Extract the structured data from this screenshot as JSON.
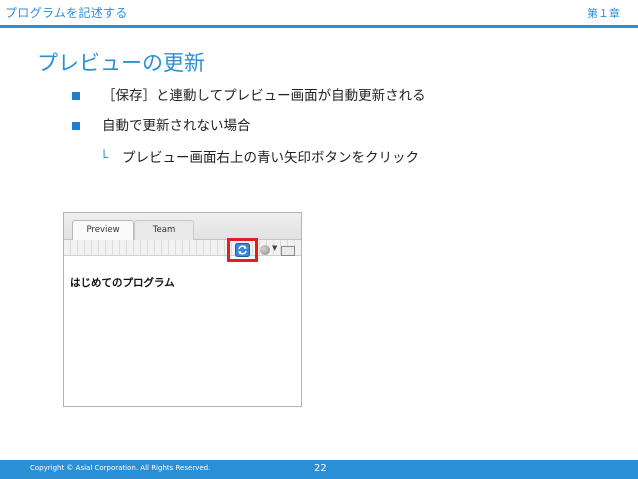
{
  "header": {
    "title": "プログラムを記述する",
    "chapter": "第１章"
  },
  "slide": {
    "title": "プレビューの更新",
    "bullets": [
      "［保存］と連動してプレビュー画面が自動更新される",
      "自動で更新されない場合"
    ],
    "sub_bullet": {
      "mark": "└",
      "text": "プレビュー画面右上の青い矢印ボタンをクリック"
    }
  },
  "screenshot": {
    "tabs": [
      "Preview",
      "Team"
    ],
    "active_tab": "Preview",
    "preview_text": "はじめてのプログラム",
    "icons": [
      "refresh-icon",
      "options-icon",
      "caret-down-icon",
      "window-icon"
    ],
    "highlight_color": "#e02020"
  },
  "footer": {
    "copyright": "Copyright © Asial Corporation. All Rights Reserved.",
    "page": "22"
  },
  "colors": {
    "accent": "#2b8fd6",
    "bullet": "#1f7fcf"
  }
}
